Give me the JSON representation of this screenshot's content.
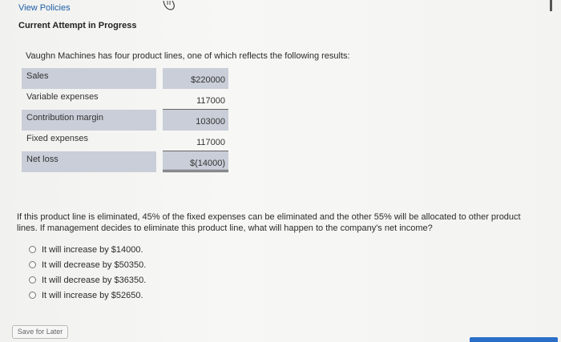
{
  "header": {
    "view_policies": "View Policies",
    "attempt_title": "Current Attempt in Progress"
  },
  "intro": "Vaughn Machines has four product lines, one of which reflects the following results:",
  "table": {
    "rows": [
      {
        "label": "Sales",
        "value": "$220000"
      },
      {
        "label": "Variable expenses",
        "value": "117000"
      },
      {
        "label": "Contribution margin",
        "value": "103000"
      },
      {
        "label": "Fixed expenses",
        "value": "117000"
      },
      {
        "label": "Net loss",
        "value": "$(14000)"
      }
    ]
  },
  "question": "If this product line is eliminated, 45% of the fixed expenses can be eliminated and the other 55% will be allocated to other product lines. If management decides to eliminate this product line, what will happen to the company's net income?",
  "options": [
    "It will increase by $14000.",
    "It will decrease by $50350.",
    "It will decrease by $36350.",
    "It will increase by $52650."
  ],
  "footer": {
    "save_label": "Save for Later"
  },
  "colors": {
    "link": "#1f5fa8",
    "table_shade": "#c9ced8",
    "accent_bar": "#2a6ec8"
  }
}
